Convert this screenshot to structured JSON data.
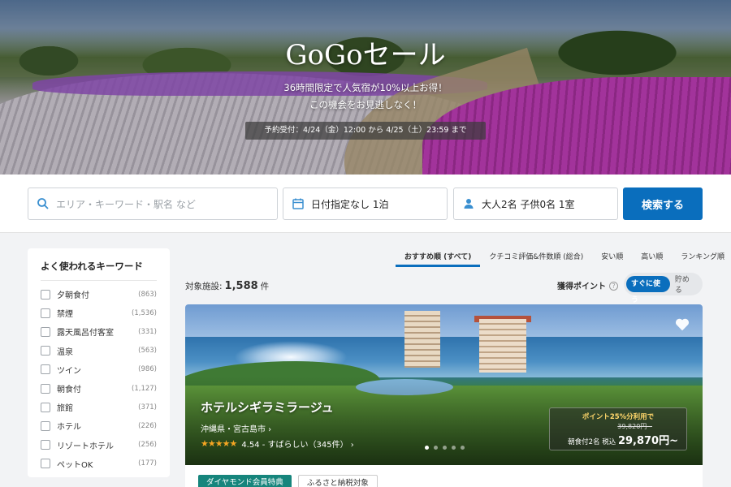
{
  "hero": {
    "title": "GoGoセール",
    "subtitle1": "36時間限定で人気宿が10%以上お得！",
    "subtitle2": "この機会をお見逃しなく！",
    "period": "予約受付：4/24（金）12:00 から 4/25（土）23:59 まで"
  },
  "search": {
    "keyword_placeholder": "エリア・キーワード・駅名 など",
    "date_value": "日付指定なし 1泊",
    "guests_value": "大人2名 子供0名 1室",
    "button_label": "検索する"
  },
  "sidebar": {
    "title": "よく使われるキーワード",
    "items": [
      {
        "label": "夕朝食付",
        "count": "(863)"
      },
      {
        "label": "禁煙",
        "count": "(1,536)"
      },
      {
        "label": "露天風呂付客室",
        "count": "(331)"
      },
      {
        "label": "温泉",
        "count": "(563)"
      },
      {
        "label": "ツイン",
        "count": "(986)"
      },
      {
        "label": "朝食付",
        "count": "(1,127)"
      },
      {
        "label": "旅館",
        "count": "(371)"
      },
      {
        "label": "ホテル",
        "count": "(226)"
      },
      {
        "label": "リゾートホテル",
        "count": "(256)"
      },
      {
        "label": "ペットOK",
        "count": "(177)"
      }
    ]
  },
  "sort_tabs": [
    {
      "label": "おすすめ順 (すべて)"
    },
    {
      "label": "クチコミ評価&件数順 (総合)"
    },
    {
      "label": "安い順"
    },
    {
      "label": "高い順"
    },
    {
      "label": "ランキング順"
    }
  ],
  "results": {
    "count_prefix": "対象施設:",
    "count_value": "1,588",
    "count_suffix": "件"
  },
  "points": {
    "label": "獲得ポイント",
    "toggle_on": "すぐに使う",
    "toggle_off": "貯める"
  },
  "hotel": {
    "name": "ホテルシギラミラージュ",
    "location": "沖縄県・宮古島市 ›",
    "stars": "★★★★★",
    "rating": "4.54 - すばらしい（345件） ›",
    "point_badge": "ポイント25%分利用で",
    "old_price": "39,820円~",
    "price_prefix": "朝食付2名 税込",
    "price": "29,870円~",
    "tags": [
      "ダイヤモンド会員特典",
      "ふるさと納税対象"
    ]
  },
  "colors": {
    "accent": "#0a6ebd",
    "diamond_tag": "#16857c",
    "star": "#f5a623"
  }
}
